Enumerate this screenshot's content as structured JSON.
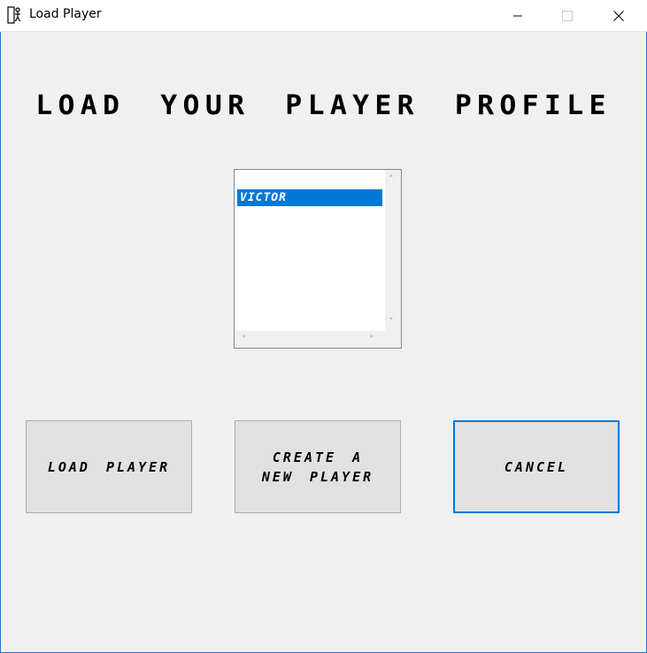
{
  "window": {
    "title": "Load Player"
  },
  "main": {
    "heading": "LOAD YOUR PLAYER PROFILE",
    "profile_list": {
      "items": [
        "VICTOR"
      ],
      "selected_index": 0
    },
    "buttons": {
      "load": "LOAD PLAYER",
      "create_line1": "CREATE A",
      "create_line2": "NEW PLAYER",
      "cancel": "CANCEL"
    }
  },
  "colors": {
    "selection": "#0078d7",
    "focus_border": "#0078d7",
    "window_border": "#1e77d0",
    "background": "#f0f0f0"
  },
  "icons": [
    "app-icon",
    "minimize-icon",
    "maximize-icon",
    "close-icon",
    "scroll-up-icon",
    "scroll-down-icon",
    "scroll-left-icon",
    "scroll-right-icon"
  ]
}
